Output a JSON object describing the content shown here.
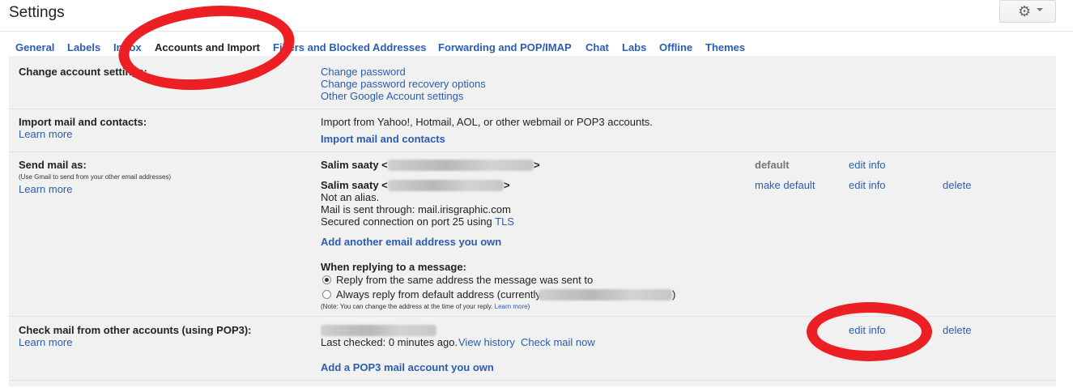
{
  "page": {
    "title": "Settings"
  },
  "header": {
    "gear_icon": "gear-icon",
    "dropdown_icon": "caret-down-icon"
  },
  "tabs": [
    {
      "label": "General"
    },
    {
      "label": "Labels"
    },
    {
      "label": "Inbox"
    },
    {
      "label": "Accounts and Import"
    },
    {
      "label": "Filters and Blocked Addresses"
    },
    {
      "label": "Forwarding and POP/IMAP"
    },
    {
      "label": "Chat"
    },
    {
      "label": "Labs"
    },
    {
      "label": "Offline"
    },
    {
      "label": "Themes"
    }
  ],
  "change_account": {
    "label": "Change account settings:",
    "links": [
      "Change password",
      "Change password recovery options",
      "Other Google Account settings"
    ]
  },
  "import": {
    "label": "Import mail and contacts:",
    "learn_more": "Learn more",
    "description": "Import from Yahoo!, Hotmail, AOL, or other webmail or POP3 accounts.",
    "action": "Import mail and contacts"
  },
  "send_as": {
    "label": "Send mail as:",
    "note": "(Use Gmail to send from your other email addresses)",
    "learn_more": "Learn more",
    "entries": [
      {
        "name": "Salim saaty <",
        "close": ">",
        "status": "default",
        "edit": "edit info"
      },
      {
        "name": "Salim saaty <",
        "close": ">",
        "status": "make default",
        "edit": "edit info",
        "delete": "delete"
      }
    ],
    "details": [
      "Not an alias.",
      "Mail is sent through: mail.irisgraphic.com",
      "Secured connection on port 25 using "
    ],
    "tls": "TLS",
    "add_address": "Add another email address you own",
    "reply_heading": "When replying to a message:",
    "reply_options": [
      "Reply from the same address the message was sent to",
      "Always reply from default address (currently"
    ],
    "reply_close": ")",
    "reply_selected": 0,
    "reply_note": "(Note: You can change the address at the time of your reply. ",
    "reply_note_link": "Learn more",
    "reply_note_close": ")"
  },
  "check_mail": {
    "label": "Check mail from other accounts (using POP3):",
    "learn_more": "Learn more",
    "last_checked": "Last checked: 0 minutes ago.",
    "view_history": "View history",
    "check_now": "Check mail now",
    "edit": "edit info",
    "delete": "delete",
    "add_account": "Add a POP3 mail account you own"
  },
  "annotation_color": "#ec1f24"
}
